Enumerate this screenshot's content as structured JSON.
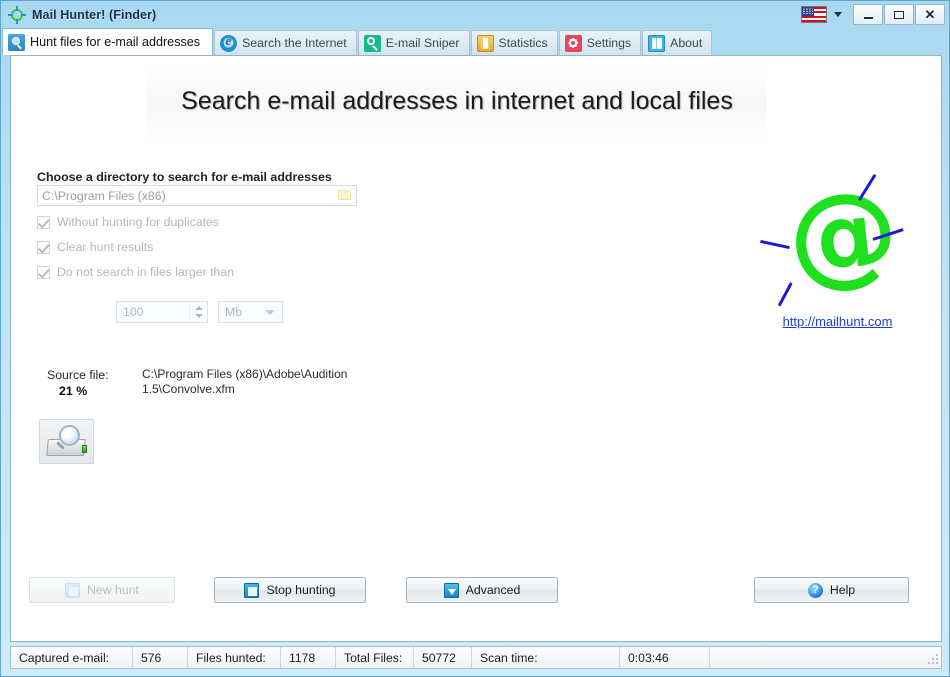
{
  "window": {
    "title": "Mail Hunter! (Finder)",
    "app_icon": "at-globe-icon",
    "language_flag": "us-flag-icon",
    "minimize_label": "",
    "maximize_label": "",
    "close_label": "✕"
  },
  "tabs": [
    {
      "label": "Hunt files for e-mail addresses",
      "icon": "hunt-files-icon",
      "active": true
    },
    {
      "label": "Search the Internet",
      "icon": "internet-explorer-icon",
      "active": false
    },
    {
      "label": "E-mail Sniper",
      "icon": "magnifier-icon",
      "active": false
    },
    {
      "label": "Statistics",
      "icon": "statistics-icon",
      "active": false
    },
    {
      "label": "Settings",
      "icon": "gear-icon",
      "active": false
    },
    {
      "label": "About",
      "icon": "book-icon",
      "active": false
    }
  ],
  "main": {
    "headline": "Search e-mail addresses in internet and local files",
    "directory_label": "Choose a directory to search for e-mail addresses",
    "directory_value": "C:\\Program Files (x86)",
    "browse_icon": "folder-icon",
    "checkboxes": [
      {
        "label": "Without hunting for duplicates",
        "checked": true,
        "enabled": false
      },
      {
        "label": "Clear hunt results",
        "checked": true,
        "enabled": false
      },
      {
        "label": "Do not search in files larger than",
        "checked": true,
        "enabled": false
      }
    ],
    "size_value": "100",
    "size_unit": "Mb",
    "source_file_label": "Source file:",
    "progress_percent": "21 %",
    "source_path": "C:\\Program Files (x86)\\Adobe\\Audition 1.5\\Convolve.xfm",
    "scan_icon": "drive-search-icon"
  },
  "logo": {
    "symbol": "@",
    "link_text": "http://mailhunt.com",
    "symbol_color": "#1ee01e",
    "ray_color": "#1a1ad0",
    "link_color": "#1c3fd8"
  },
  "buttons": [
    {
      "label": "New hunt",
      "icon": "new-hunt-icon",
      "enabled": false
    },
    {
      "label": "Stop hunting",
      "icon": "stop-hunting-icon",
      "enabled": true
    },
    {
      "label": "Advanced",
      "icon": "advanced-icon",
      "enabled": true
    },
    {
      "label": "Help",
      "icon": "help-icon",
      "enabled": true
    }
  ],
  "statusbar": [
    {
      "label": "Captured e-mail:",
      "value": "576"
    },
    {
      "label": "Files hunted:",
      "value": "1178"
    },
    {
      "label": "Total Files:",
      "value": "50772"
    },
    {
      "label": "Scan time:",
      "value": "0:03:46"
    }
  ]
}
